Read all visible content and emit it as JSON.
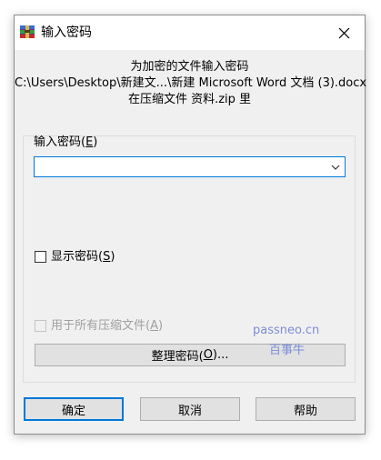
{
  "window": {
    "title": "输入密码",
    "close_glyph": "✕"
  },
  "info": {
    "line1": "为加密的文件输入密码",
    "line2": "C:\\Users\\Desktop\\新建文...\\新建 Microsoft Word 文档 (3).docx",
    "line3": "在压缩文件 资料.zip 里"
  },
  "password_field": {
    "label": "输入密码(",
    "hotkey": "E",
    "label_end": ")",
    "value": ""
  },
  "show_password": {
    "label": "显示密码(",
    "hotkey": "S",
    "label_end": ")",
    "checked": false
  },
  "use_for_all": {
    "label": "用于所有压缩文件(",
    "hotkey": "A",
    "label_end": ")",
    "checked": false,
    "disabled": true
  },
  "organize_button": {
    "label": "整理密码(",
    "hotkey": "O",
    "label_end": ")..."
  },
  "buttons": {
    "ok": "确定",
    "cancel": "取消",
    "help": "帮助"
  },
  "watermark": {
    "line1": "passneo.cn",
    "line2": "百事牛"
  },
  "colors": {
    "accent": "#0078d7",
    "dialog_bg": "#f0f0f0",
    "button_bg": "#e1e1e1",
    "watermark": "#7d8ed6"
  }
}
